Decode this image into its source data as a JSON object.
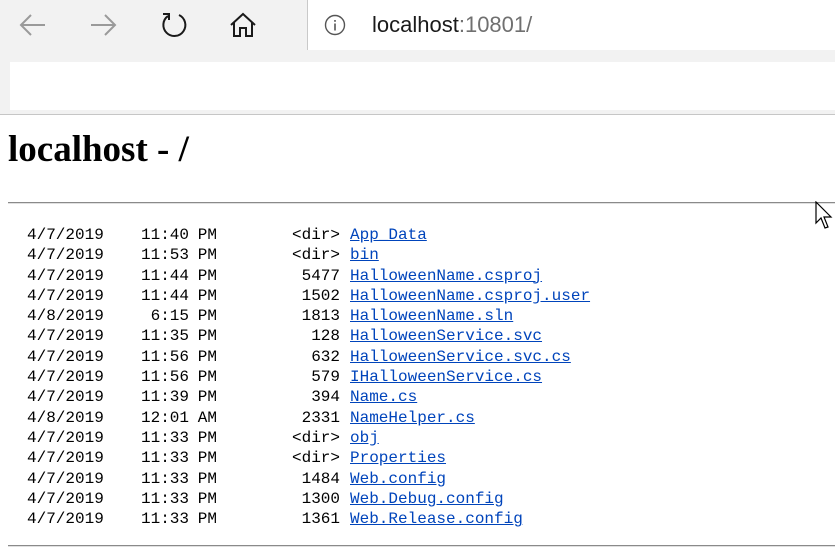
{
  "browser": {
    "url_host": "localhost",
    "url_rest": ":10801/",
    "icons": {
      "back": "arrow-left-icon",
      "forward": "arrow-right-icon",
      "refresh": "refresh-icon",
      "home": "home-icon",
      "info": "info-circle-icon"
    }
  },
  "page": {
    "title": "localhost - /"
  },
  "listing": {
    "rows": [
      {
        "date": "4/7/2019",
        "time": "11:40",
        "ampm": "PM",
        "size": "<dir>",
        "name": "App_Data"
      },
      {
        "date": "4/7/2019",
        "time": "11:53",
        "ampm": "PM",
        "size": "<dir>",
        "name": "bin"
      },
      {
        "date": "4/7/2019",
        "time": "11:44",
        "ampm": "PM",
        "size": "5477",
        "name": "HalloweenName.csproj"
      },
      {
        "date": "4/7/2019",
        "time": "11:44",
        "ampm": "PM",
        "size": "1502",
        "name": "HalloweenName.csproj.user"
      },
      {
        "date": "4/8/2019",
        "time": "6:15",
        "ampm": "PM",
        "size": "1813",
        "name": "HalloweenName.sln"
      },
      {
        "date": "4/7/2019",
        "time": "11:35",
        "ampm": "PM",
        "size": "128",
        "name": "HalloweenService.svc"
      },
      {
        "date": "4/7/2019",
        "time": "11:56",
        "ampm": "PM",
        "size": "632",
        "name": "HalloweenService.svc.cs"
      },
      {
        "date": "4/7/2019",
        "time": "11:56",
        "ampm": "PM",
        "size": "579",
        "name": "IHalloweenService.cs"
      },
      {
        "date": "4/7/2019",
        "time": "11:39",
        "ampm": "PM",
        "size": "394",
        "name": "Name.cs"
      },
      {
        "date": "4/8/2019",
        "time": "12:01",
        "ampm": "AM",
        "size": "2331",
        "name": "NameHelper.cs"
      },
      {
        "date": "4/7/2019",
        "time": "11:33",
        "ampm": "PM",
        "size": "<dir>",
        "name": "obj"
      },
      {
        "date": "4/7/2019",
        "time": "11:33",
        "ampm": "PM",
        "size": "<dir>",
        "name": "Properties"
      },
      {
        "date": "4/7/2019",
        "time": "11:33",
        "ampm": "PM",
        "size": "1484",
        "name": "Web.config"
      },
      {
        "date": "4/7/2019",
        "time": "11:33",
        "ampm": "PM",
        "size": "1300",
        "name": "Web.Debug.config"
      },
      {
        "date": "4/7/2019",
        "time": "11:33",
        "ampm": "PM",
        "size": "1361",
        "name": "Web.Release.config"
      }
    ]
  },
  "colors": {
    "link": "#0044bb",
    "chrome": "#f2f2f2"
  }
}
